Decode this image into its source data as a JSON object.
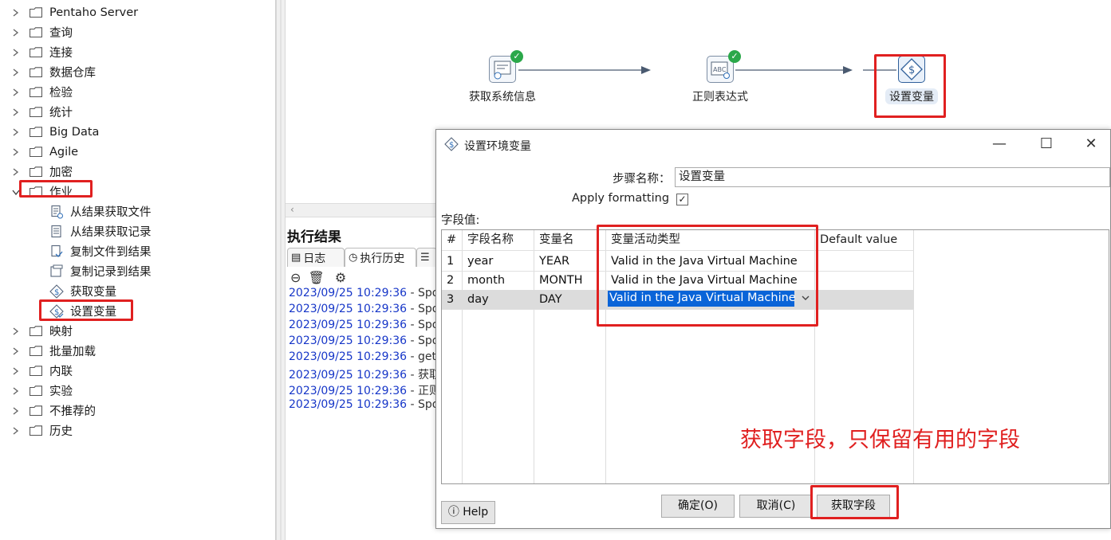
{
  "tree": {
    "folders_top": [
      "Pentaho Server",
      "查询",
      "连接",
      "数据仓库",
      "检验",
      "统计",
      "Big Data",
      "Agile",
      "加密",
      "作业"
    ],
    "job_items": [
      "从结果获取文件",
      "从结果获取记录",
      "复制文件到结果",
      "复制记录到结果",
      "获取变量",
      "设置变量"
    ],
    "folders_bottom": [
      "映射",
      "批量加载",
      "内联",
      "实验",
      "不推荐的",
      "历史"
    ]
  },
  "canvas": {
    "steps": [
      "获取系统信息",
      "正则表达式",
      "设置变量"
    ]
  },
  "results": {
    "title": "执行结果",
    "tabs": [
      "日志",
      "执行历史"
    ],
    "log": [
      {
        "ts": "2023/09/25 10:29:36",
        "msg": " - Spo"
      },
      {
        "ts": "2023/09/25 10:29:36",
        "msg": " - Spo"
      },
      {
        "ts": "2023/09/25 10:29:36",
        "msg": " - Spo"
      },
      {
        "ts": "2023/09/25 10:29:36",
        "msg": " - Spo"
      },
      {
        "ts": "2023/09/25 10:29:36",
        "msg": " - get"
      },
      {
        "ts": "2023/09/25 10:29:36",
        "msg": " - 获取"
      },
      {
        "ts": "2023/09/25 10:29:36",
        "msg": " - 正则"
      },
      {
        "ts": "2023/09/25 10:29:36",
        "msg": " - Spo"
      }
    ]
  },
  "dialog": {
    "title": "设置环境变量",
    "step_name_label": "步骤名称：",
    "step_name_value": "设置变量",
    "apply_formatting_label": "Apply formatting",
    "apply_formatting_checked": true,
    "fields_label": "字段值:",
    "headers": [
      "#",
      "字段名称",
      "变量名",
      "变量活动类型",
      "Default value"
    ],
    "rows": [
      {
        "n": "1",
        "field": "year",
        "var": "YEAR",
        "type": "Valid in the Java Virtual Machine",
        "def": ""
      },
      {
        "n": "2",
        "field": "month",
        "var": "MONTH",
        "type": "Valid in the Java Virtual Machine",
        "def": ""
      },
      {
        "n": "3",
        "field": "day",
        "var": "DAY",
        "type": "Valid in the Java Virtual Machine",
        "def": ""
      }
    ],
    "help_label": "Help",
    "ok_label": "确定(O)",
    "cancel_label": "取消(C)",
    "get_fields_label": "获取字段"
  },
  "annotation": "获取字段，只保留有用的字段",
  "colors": {
    "highlight_red": "#e02020",
    "selection_blue": "#0a64d8",
    "ok_green": "#2ba84a",
    "log_blue": "#1636c8"
  }
}
